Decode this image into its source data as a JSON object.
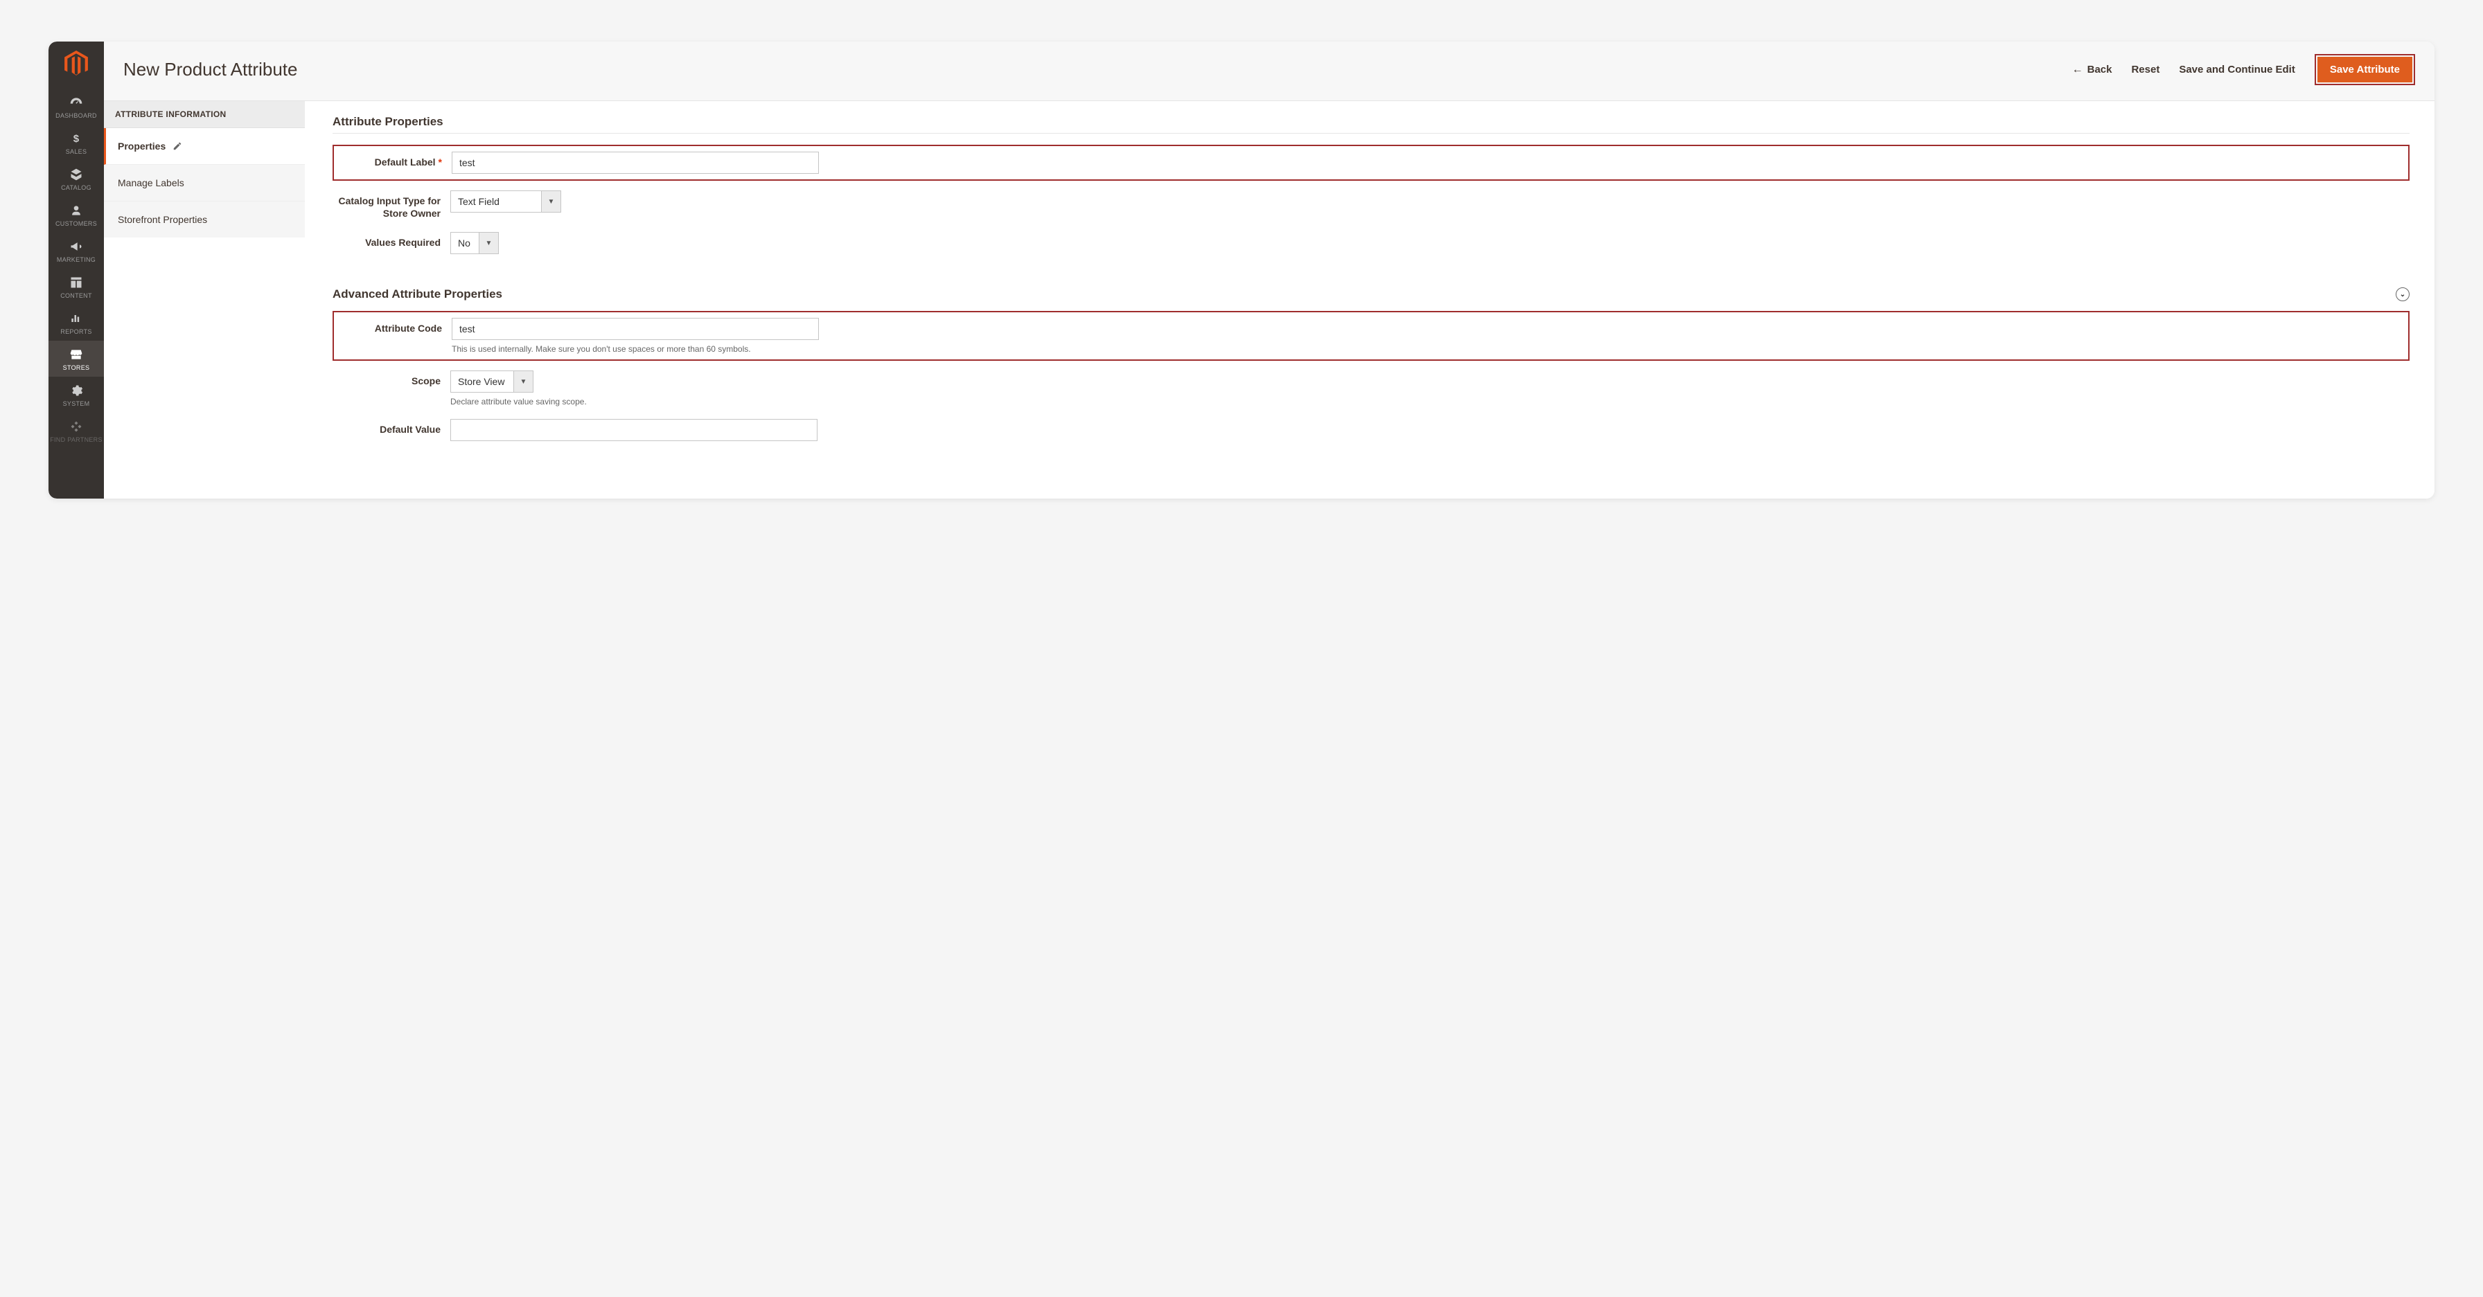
{
  "sidebar": {
    "items": [
      {
        "label": "DASHBOARD"
      },
      {
        "label": "SALES"
      },
      {
        "label": "CATALOG"
      },
      {
        "label": "CUSTOMERS"
      },
      {
        "label": "MARKETING"
      },
      {
        "label": "CONTENT"
      },
      {
        "label": "REPORTS"
      },
      {
        "label": "STORES"
      },
      {
        "label": "SYSTEM"
      },
      {
        "label": "FIND PARTNERS"
      }
    ]
  },
  "header": {
    "title": "New Product Attribute",
    "back": "Back",
    "reset": "Reset",
    "save_continue": "Save and Continue Edit",
    "save": "Save Attribute"
  },
  "tabs": {
    "header": "ATTRIBUTE INFORMATION",
    "properties": "Properties",
    "manage_labels": "Manage Labels",
    "storefront": "Storefront Properties"
  },
  "sections": {
    "attr_props": "Attribute Properties",
    "adv_props": "Advanced Attribute Properties"
  },
  "fields": {
    "default_label": {
      "label": "Default Label",
      "value": "test"
    },
    "input_type": {
      "label": "Catalog Input Type for Store Owner",
      "value": "Text Field"
    },
    "values_required": {
      "label": "Values Required",
      "value": "No"
    },
    "attr_code": {
      "label": "Attribute Code",
      "value": "test",
      "note": "This is used internally. Make sure you don't use spaces or more than 60 symbols."
    },
    "scope": {
      "label": "Scope",
      "value": "Store View",
      "note": "Declare attribute value saving scope."
    },
    "default_value": {
      "label": "Default Value",
      "value": ""
    }
  }
}
